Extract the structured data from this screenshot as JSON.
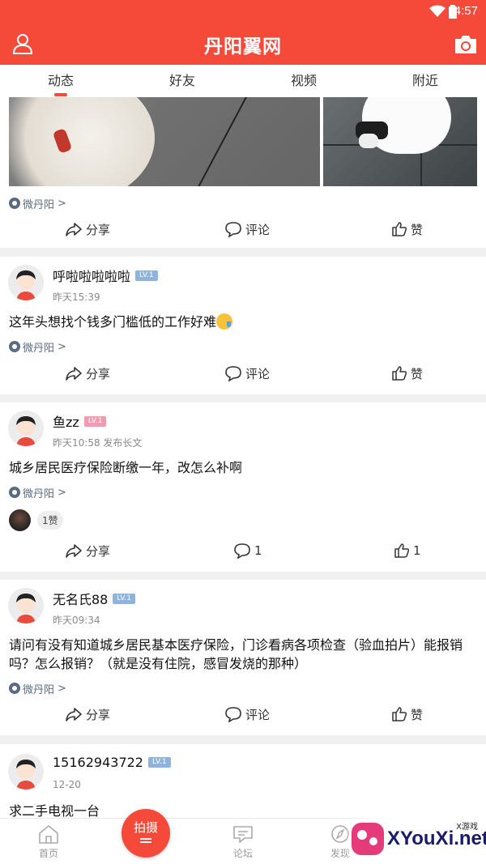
{
  "status": {
    "time": "4:57"
  },
  "app": {
    "title": "丹阳翼网"
  },
  "tabs": [
    {
      "label": "动态",
      "active": true
    },
    {
      "label": "好友",
      "active": false
    },
    {
      "label": "视频",
      "active": false
    },
    {
      "label": "附近",
      "active": false
    }
  ],
  "posts": [
    {
      "source": "微丹阳",
      "actions": {
        "share": "分享",
        "comment": "评论",
        "like": "赞"
      }
    },
    {
      "username": "呼啦啦啦啦啦",
      "level": "LV.1",
      "meta": "昨天15:39",
      "content": "这年头想找个钱多门槛低的工作好难",
      "source": "微丹阳",
      "actions": {
        "share": "分享",
        "comment": "评论",
        "like": "赞"
      }
    },
    {
      "username": "鱼zz",
      "level": "LV.1",
      "meta": "昨天10:58 发布长文",
      "content": "城乡居民医疗保险断缴一年，改怎么补啊",
      "source": "微丹阳",
      "likes_badge": "1赞",
      "actions": {
        "share": "分享",
        "comment": "1",
        "like": "1"
      }
    },
    {
      "username": "无名氏88",
      "level": "LV.1",
      "meta": "昨天09:34",
      "content": "请问有没有知道城乡居民基本医疗保险，门诊看病各项检查（验血拍片）能报销吗？怎么报销？（就是没有住院，感冒发烧的那种）",
      "source": "微丹阳",
      "actions": {
        "share": "分享",
        "comment": "评论",
        "like": "赞"
      }
    },
    {
      "username": "15162943722",
      "level": "LV.1",
      "meta": "12-20",
      "content": "求二手电视一台"
    }
  ],
  "bottom_nav": {
    "home": "首页",
    "shoot": "拍摄",
    "forum": "论坛",
    "discover": "发现"
  },
  "watermark": {
    "text": "XYouXi.net",
    "tag": "X游戏"
  },
  "colors": {
    "brand": "#f5493a",
    "source": "#5a6a80"
  }
}
